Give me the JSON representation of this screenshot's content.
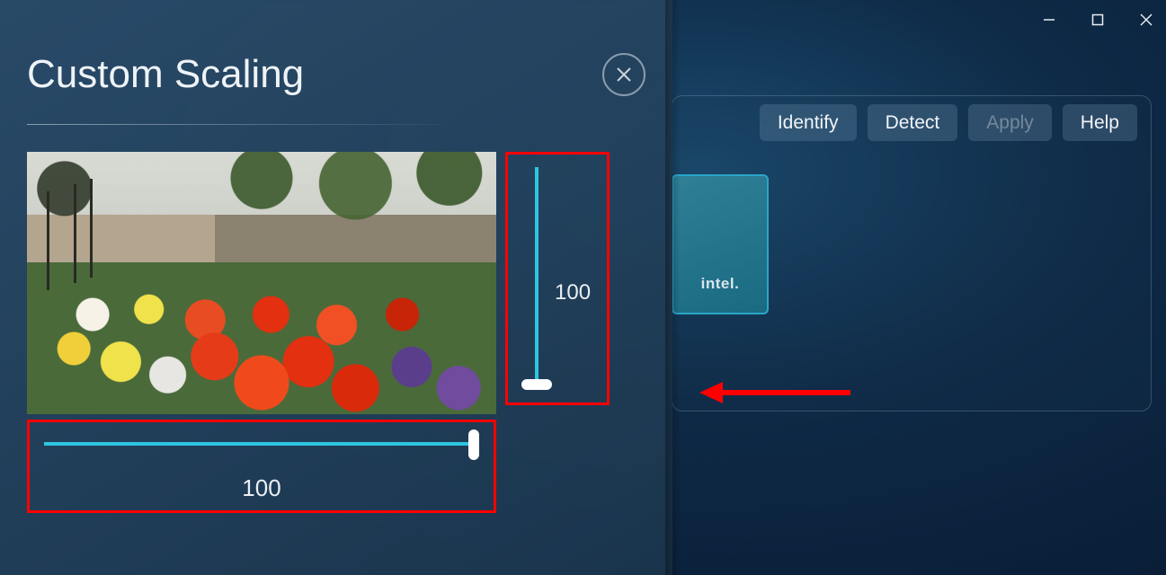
{
  "window": {
    "minimize": "minimize",
    "maximize": "maximize",
    "close": "close"
  },
  "toolbar": {
    "identify": "Identify",
    "detect": "Detect",
    "apply": "Apply",
    "help": "Help"
  },
  "intel_tile": {
    "logo_text": "intel."
  },
  "dialog": {
    "title": "Custom Scaling",
    "close": "close",
    "vertical_value": "100",
    "horizontal_value": "100"
  },
  "annotation": {
    "arrow": "red-arrow-left"
  }
}
